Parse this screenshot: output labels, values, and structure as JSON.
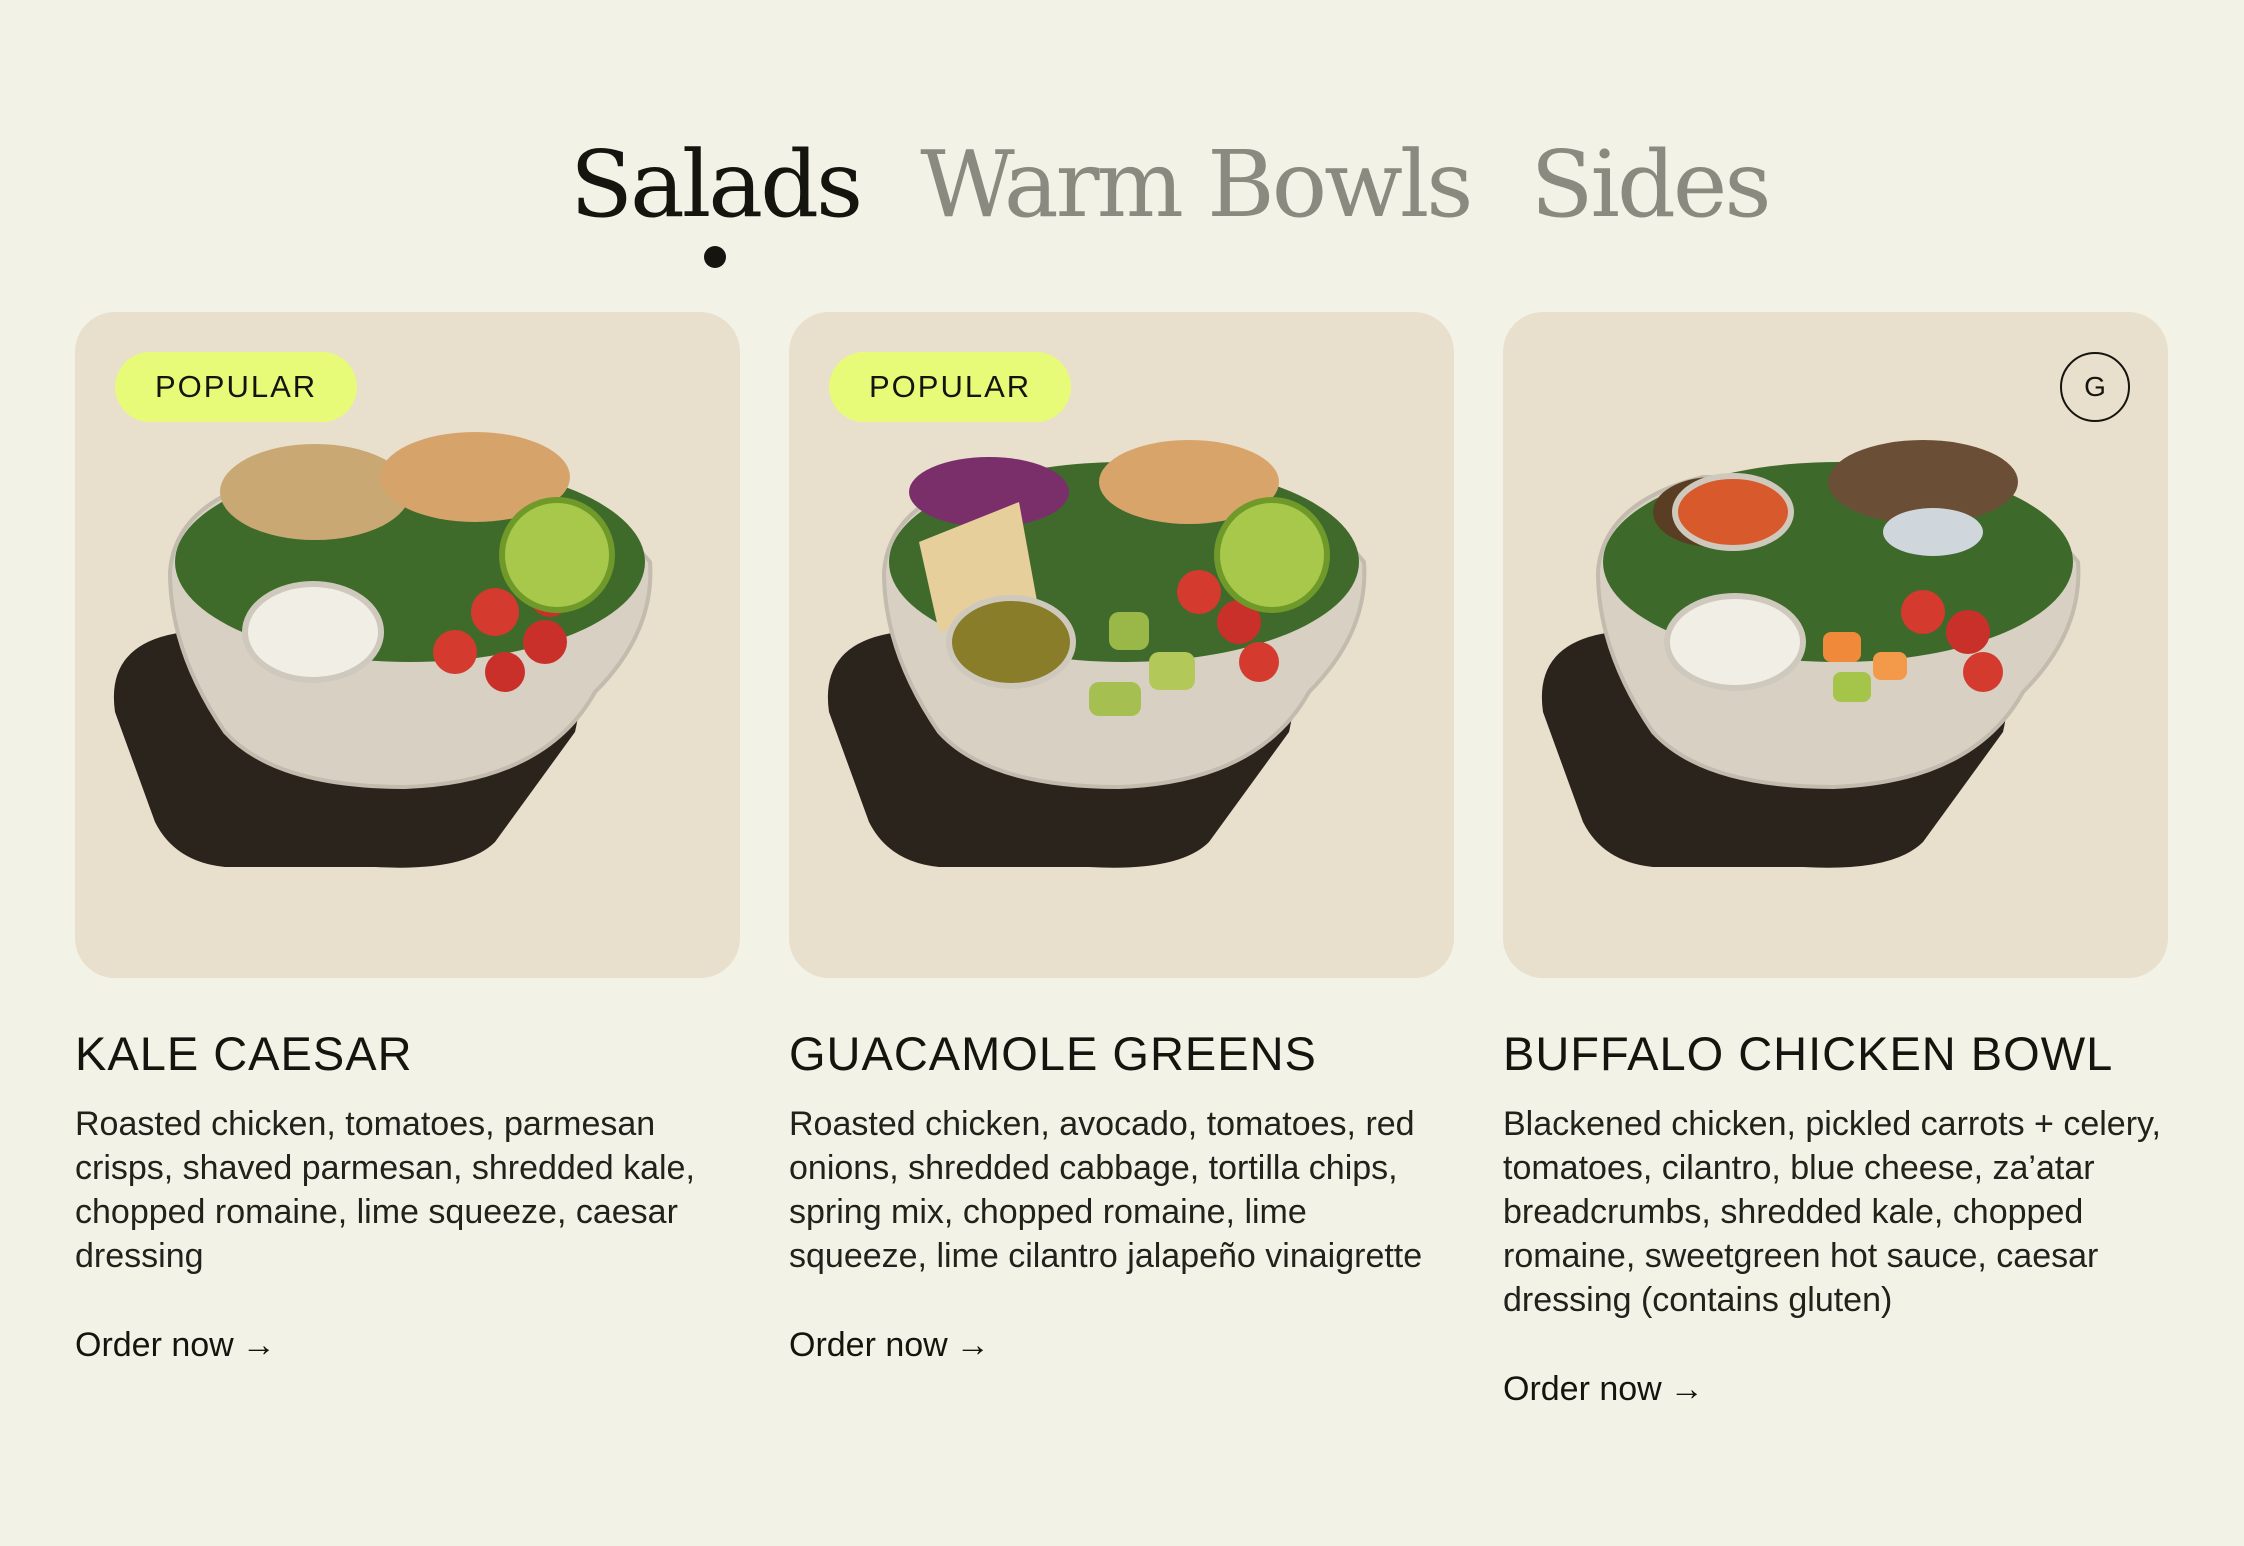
{
  "tabs": [
    {
      "label": "Salads",
      "active": true
    },
    {
      "label": "Warm Bowls",
      "active": false
    },
    {
      "label": "Sides",
      "active": false
    }
  ],
  "cards": [
    {
      "badge": "POPULAR",
      "title": "KALE CAESAR",
      "description": "Roasted chicken, tomatoes, parmesan crisps, shaved parmesan, shredded kale, chopped romaine, lime squeeze, caesar dressing",
      "cta": "Order now",
      "cta_icon": "arrow-right-icon"
    },
    {
      "badge": "POPULAR",
      "title": "GUACAMOLE GREENS",
      "description": "Roasted chicken, avocado, tomatoes, red onions, shredded cabbage, tortilla chips, spring mix, chopped romaine, lime squeeze, lime cilantro jalapeño vinaigrette",
      "cta": "Order now",
      "cta_icon": "arrow-right-icon"
    },
    {
      "badge_icon": "G",
      "title": "BUFFALO CHICKEN BOWL",
      "description": "Blackened chicken, pickled carrots + celery, tomatoes, cilantro, blue cheese, za’atar breadcrumbs, shredded kale, chopped romaine, sweetgreen hot sauce, caesar dressing (contains gluten)",
      "cta": "Order now",
      "cta_icon": "arrow-right-icon"
    }
  ],
  "colors": {
    "background": "#f3f2e7",
    "card_bg": "#e8dfcc",
    "badge_bg": "#e8fb79",
    "active_tab": "#15150f",
    "inactive_tab": "#8a8a80"
  }
}
